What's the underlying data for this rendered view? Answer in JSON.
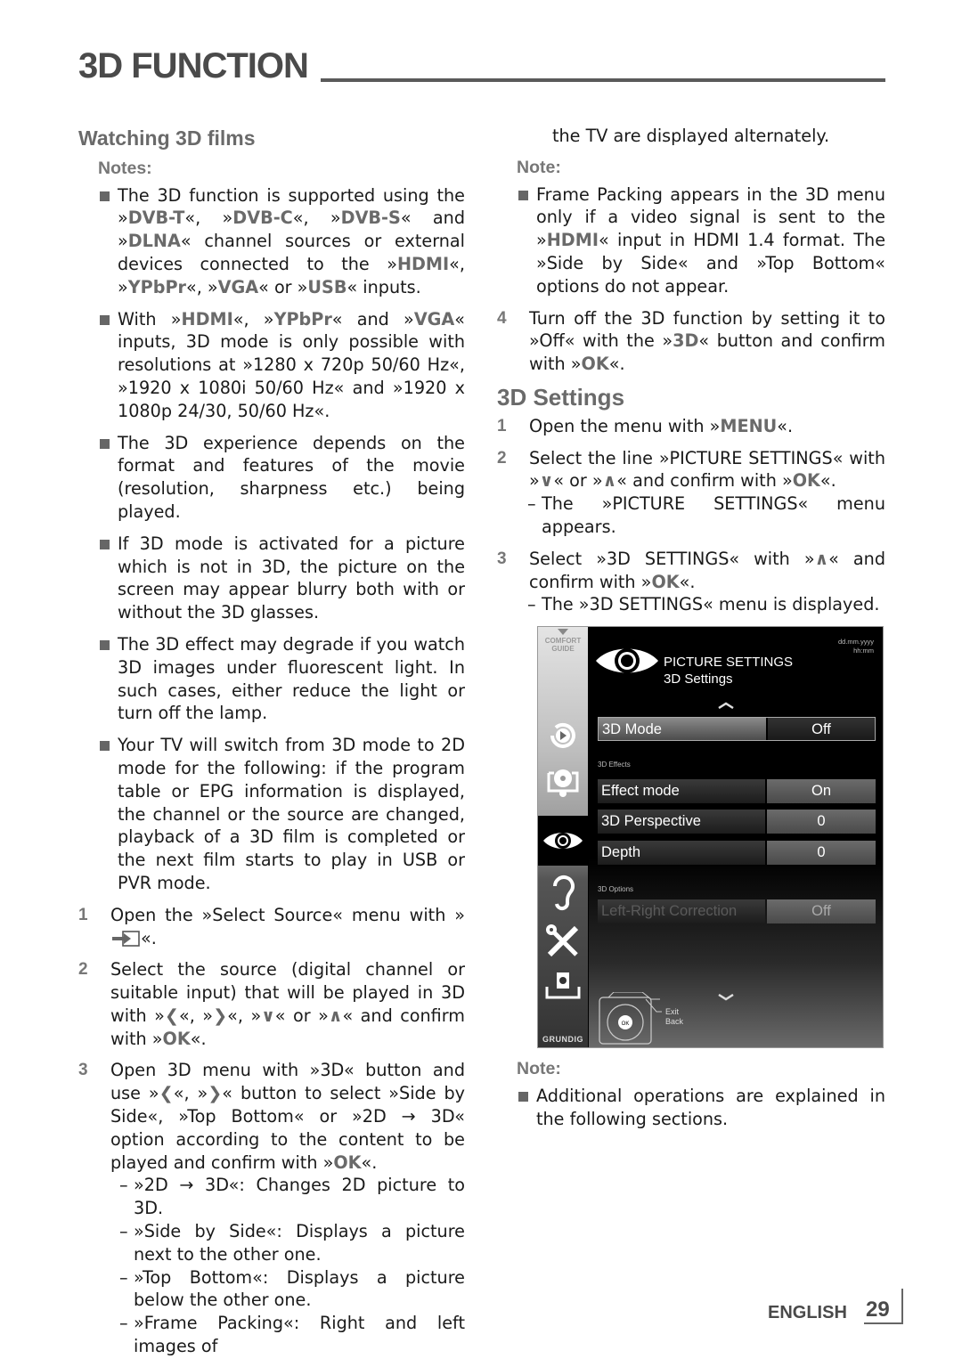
{
  "header": {
    "title": "3D FUNCTION"
  },
  "left": {
    "section_title": "Watching 3D films",
    "notes_title": "Notes:",
    "notes": [
      {
        "parts": [
          [
            "The 3D function is supported using the »",
            0
          ],
          [
            "DVB-T",
            1
          ],
          [
            "«, »",
            0
          ],
          [
            "DVB-C",
            1
          ],
          [
            "«, »",
            0
          ],
          [
            "DVB-S",
            1
          ],
          [
            "« and »",
            0
          ],
          [
            "DLNA",
            1
          ],
          [
            "« channel sources or external devices connected to the »",
            0
          ],
          [
            "HDMI",
            1
          ],
          [
            "«, »",
            0
          ],
          [
            "YPbPr",
            1
          ],
          [
            "«, »",
            0
          ],
          [
            "VGA",
            1
          ],
          [
            "« or »",
            0
          ],
          [
            "USB",
            1
          ],
          [
            "« inputs.",
            0
          ]
        ]
      },
      {
        "parts": [
          [
            "With »",
            0
          ],
          [
            "HDMI",
            1
          ],
          [
            "«, »",
            0
          ],
          [
            "YPbPr",
            1
          ],
          [
            "« and »",
            0
          ],
          [
            "VGA",
            1
          ],
          [
            "« inputs, 3D mode is only possible with resolutions at »1280 x 720p 50/60 Hz«, »1920 x 1080i 50/60 Hz« and »1920 x 1080p 24/30, 50/60 Hz«.",
            0
          ]
        ]
      },
      {
        "parts": [
          [
            "The 3D experience depends on the format and features of the movie (resolution, sharpness etc.) being played.",
            0
          ]
        ]
      },
      {
        "parts": [
          [
            "If 3D mode is activated for a picture which is not in 3D, the picture on the screen may appear blurry both with or without the 3D glasses.",
            0
          ]
        ]
      },
      {
        "parts": [
          [
            "The 3D effect may degrade if you watch 3D images under fluorescent light. In such cases, either reduce the light or turn off the lamp.",
            0
          ]
        ]
      },
      {
        "parts": [
          [
            "Your TV will switch from 3D mode to 2D mode for the following: if the program table or EPG information is displayed, the channel or the source are changed, playback of a 3D film is completed or the next film starts to play in USB or PVR mode.",
            0
          ]
        ]
      }
    ],
    "steps": [
      {
        "num": "1",
        "parts": [
          [
            "Open the »Select Source« menu with »",
            0
          ],
          [
            "[source-icon]",
            2
          ],
          [
            "«.",
            0
          ]
        ]
      },
      {
        "num": "2",
        "parts": [
          [
            "Select the source (digital channel or suitable input) that will be played in 3D with »",
            0
          ],
          [
            "<",
            3
          ],
          [
            "«, »",
            0
          ],
          [
            ">",
            3
          ],
          [
            "«, »",
            0
          ],
          [
            "V",
            3
          ],
          [
            "« or »",
            0
          ],
          [
            "Λ",
            3
          ],
          [
            "« and confirm with »",
            0
          ],
          [
            "OK",
            1
          ],
          [
            "«.",
            0
          ]
        ]
      },
      {
        "num": "3",
        "parts": [
          [
            "Open 3D menu with »3D« button and use »",
            0
          ],
          [
            "<",
            3
          ],
          [
            "«, »",
            0
          ],
          [
            ">",
            3
          ],
          [
            "« button to select »Side by Side«, »Top Bottom« or »2D → 3D« option according to the content to be played and confirm with »",
            0
          ],
          [
            "OK",
            1
          ],
          [
            "«.",
            0
          ]
        ],
        "subs": [
          "»2D → 3D«: Changes 2D picture to 3D.",
          "»Side by Side«: Displays a picture next to the other one.",
          "»Top Bottom«: Displays a picture below the other one.",
          "»Frame Packing«: Right and left images of"
        ]
      }
    ]
  },
  "right": {
    "continuation": "the TV are displayed alternately.",
    "note_title": "Note:",
    "note": {
      "parts": [
        [
          "Frame Packing appears in the 3D menu only if a video signal is sent to the »",
          0
        ],
        [
          "HDMI",
          1
        ],
        [
          "« input in HDMI 1.4 format. The »Side by Side« and »Top Bottom« options do not appear.",
          0
        ]
      ]
    },
    "step4": {
      "num": "4",
      "parts": [
        [
          "Turn off the 3D function by setting it to »Off« with the »",
          0
        ],
        [
          "3D",
          1
        ],
        [
          "« button and confirm with »",
          0
        ],
        [
          "OK",
          1
        ],
        [
          "«.",
          0
        ]
      ]
    },
    "settings_title": "3D Settings",
    "settings_steps": [
      {
        "num": "1",
        "parts": [
          [
            "Open the menu with »",
            0
          ],
          [
            "MENU",
            1
          ],
          [
            "«.",
            0
          ]
        ]
      },
      {
        "num": "2",
        "parts": [
          [
            "Select the line »PICTURE SETTINGS« with »",
            0
          ],
          [
            "V",
            3
          ],
          [
            "« or »",
            0
          ],
          [
            "Λ",
            3
          ],
          [
            "« and confirm with »",
            0
          ],
          [
            "OK",
            1
          ],
          [
            "«.",
            0
          ]
        ],
        "subs": [
          "The »PICTURE SETTINGS« menu appears."
        ]
      },
      {
        "num": "3",
        "parts": [
          [
            "Select »3D SETTINGS« with »",
            0
          ],
          [
            "Λ",
            3
          ],
          [
            "« and confirm with »",
            0
          ],
          [
            "OK",
            1
          ],
          [
            "«.",
            0
          ]
        ],
        "subs": [
          "The »3D SETTINGS« menu is displayed."
        ]
      }
    ],
    "note2_title": "Note:",
    "note2": {
      "parts": [
        [
          "Additional operations are explained in the following sections.",
          0
        ]
      ]
    }
  },
  "tv_menu": {
    "comfort_guide": [
      "COMFORT",
      "GUIDE"
    ],
    "date": "dd.mm.yyyy",
    "time": "hh:mm",
    "title": "PICTURE SETTINGS",
    "subtitle": "3D Settings",
    "rows": {
      "mode": {
        "label": "3D Mode",
        "value": "Off"
      },
      "effects_group": "3D Effects",
      "effect_mode": {
        "label": "Effect mode",
        "value": "On"
      },
      "perspective": {
        "label": "3D Perspective",
        "value": "0"
      },
      "depth": {
        "label": "Depth",
        "value": "0"
      },
      "options_group": "3D Options",
      "lr_correction": {
        "label": "Left-Right Correction",
        "value": "Off"
      }
    },
    "remote": {
      "ok": "OK",
      "exit": "Exit",
      "back": "Back"
    },
    "brand": "GRUNDIG",
    "sidebar_icons": [
      "source-play-icon",
      "media-icon",
      "picture-eye-icon",
      "sound-ear-icon",
      "tools-icon",
      "network-icon"
    ],
    "active_sidebar": "picture-eye-icon"
  },
  "footer": {
    "language": "ENGLISH",
    "page": "29"
  }
}
